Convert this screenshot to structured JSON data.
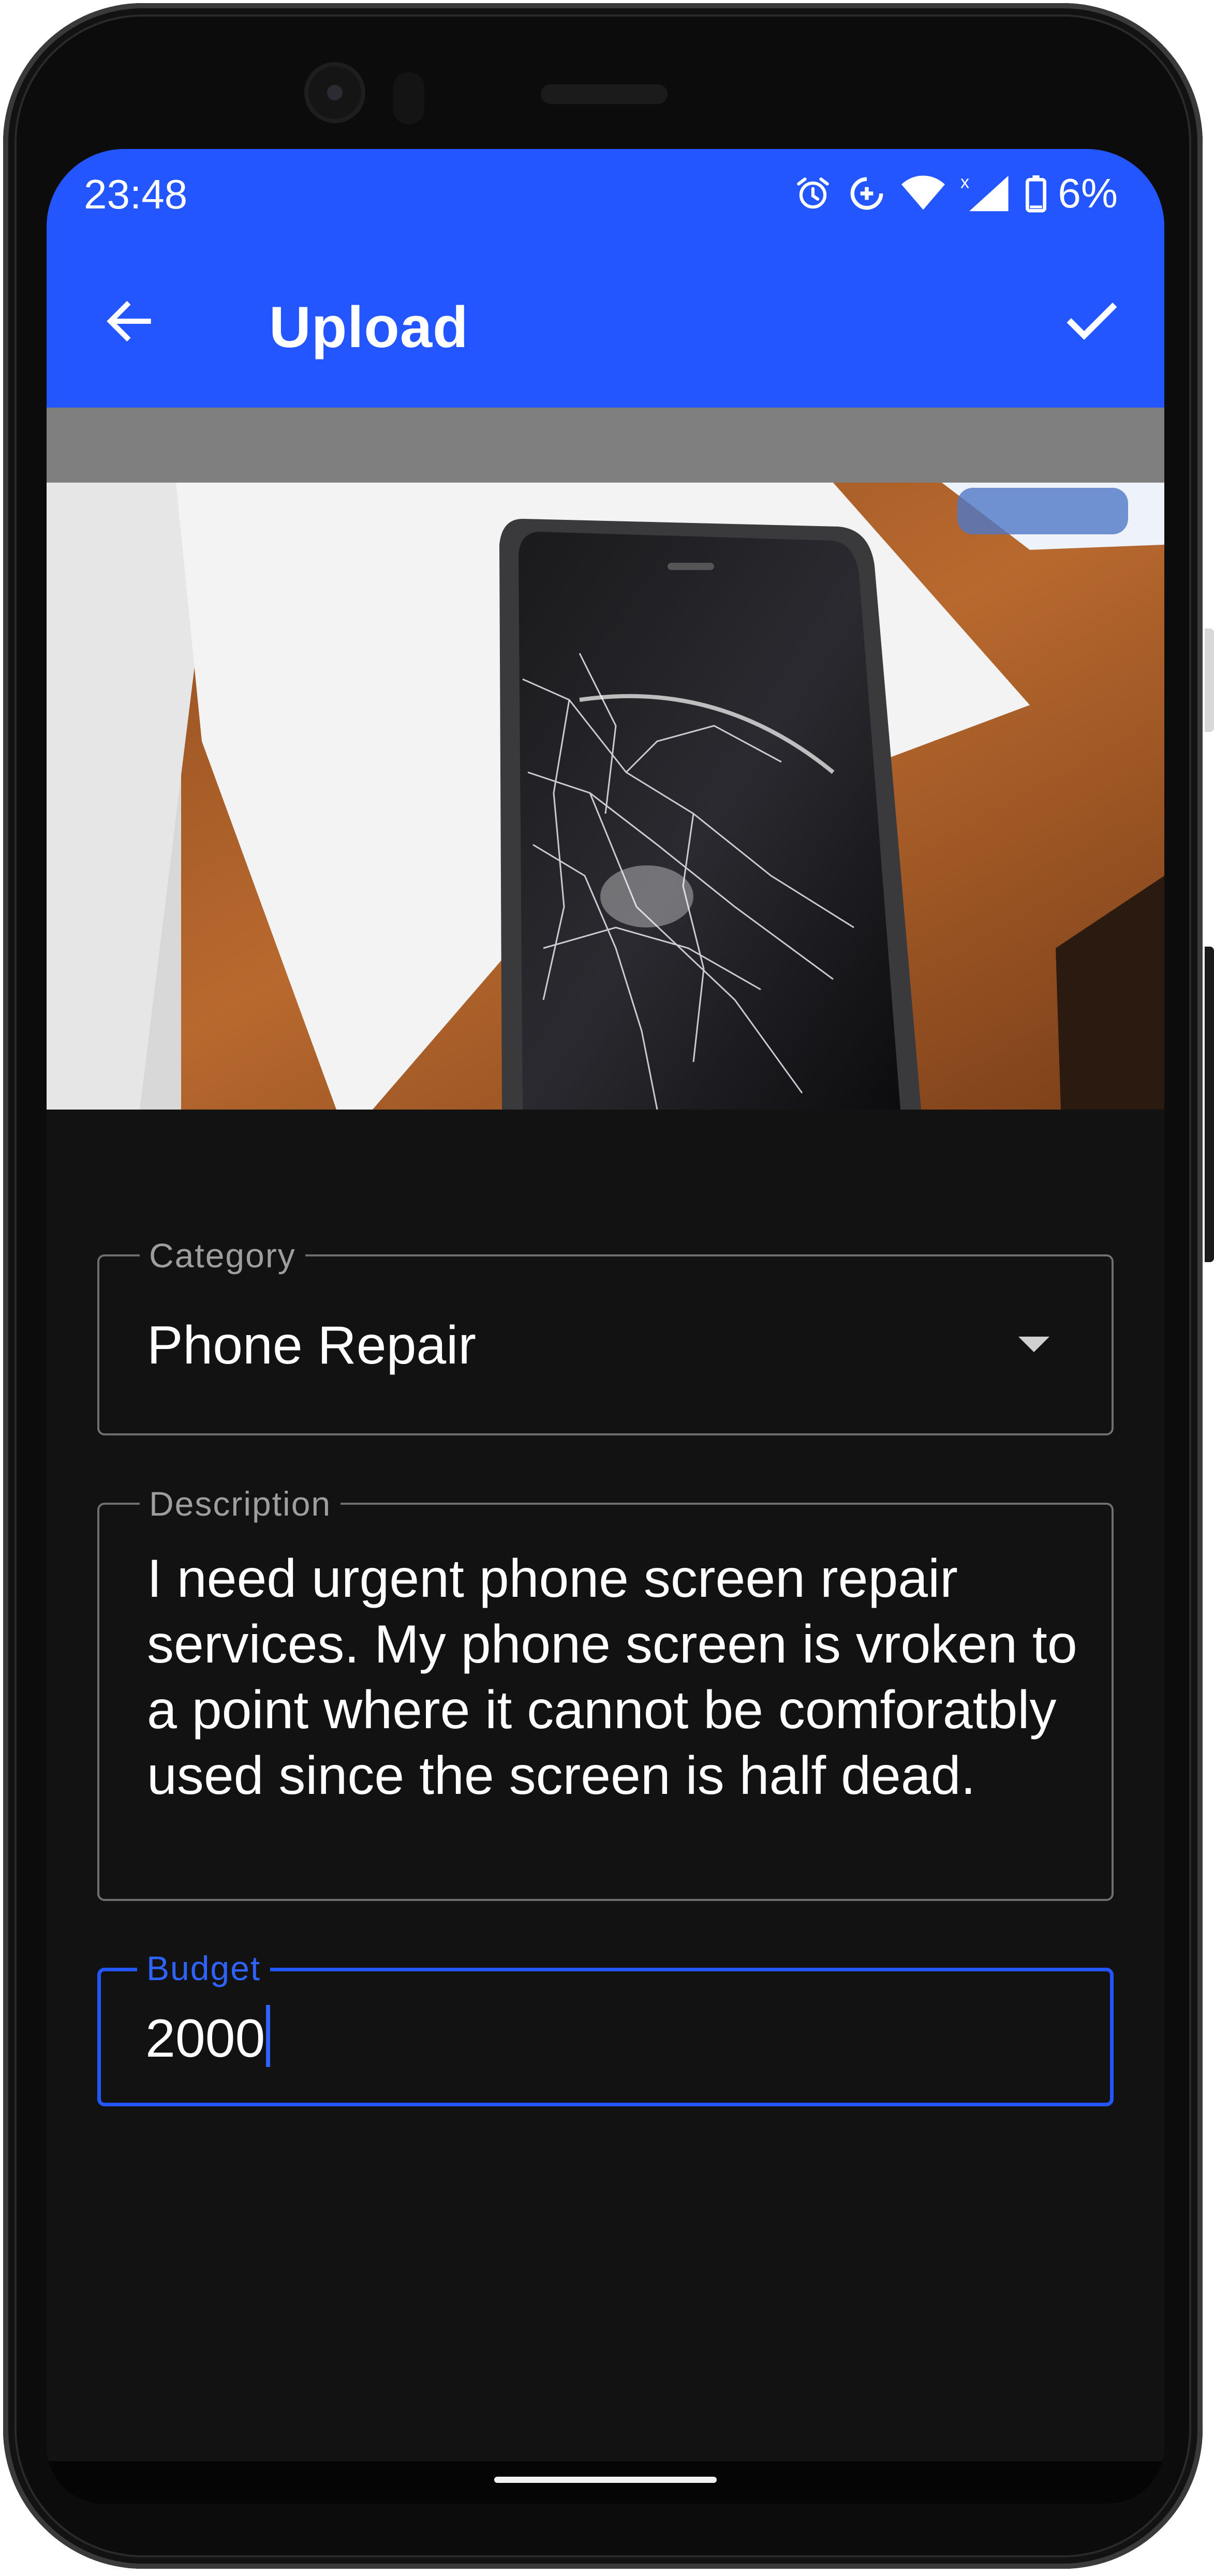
{
  "status_bar": {
    "time": "23:48",
    "battery": "6%",
    "icons": [
      "alarm-icon",
      "data-saver-icon",
      "wifi-icon",
      "signal-icon",
      "battery-icon"
    ]
  },
  "app_bar": {
    "title": "Upload",
    "back_icon": "arrow-back-icon",
    "confirm_icon": "check-icon"
  },
  "photo": {
    "subject": "cracked-phone-photo"
  },
  "form": {
    "category": {
      "label": "Category",
      "value": "Phone Repair"
    },
    "description": {
      "label": "Description",
      "value": "I need urgent phone screen repair services. My phone screen is vroken to a point where it cannot be comforatbly used since the screen is half dead."
    },
    "budget": {
      "label": "Budget",
      "value": "2000"
    }
  },
  "colors": {
    "primary": "#2356ff",
    "background": "#121212",
    "outline": "#6f6f6f",
    "label": "#9e9e9e"
  }
}
